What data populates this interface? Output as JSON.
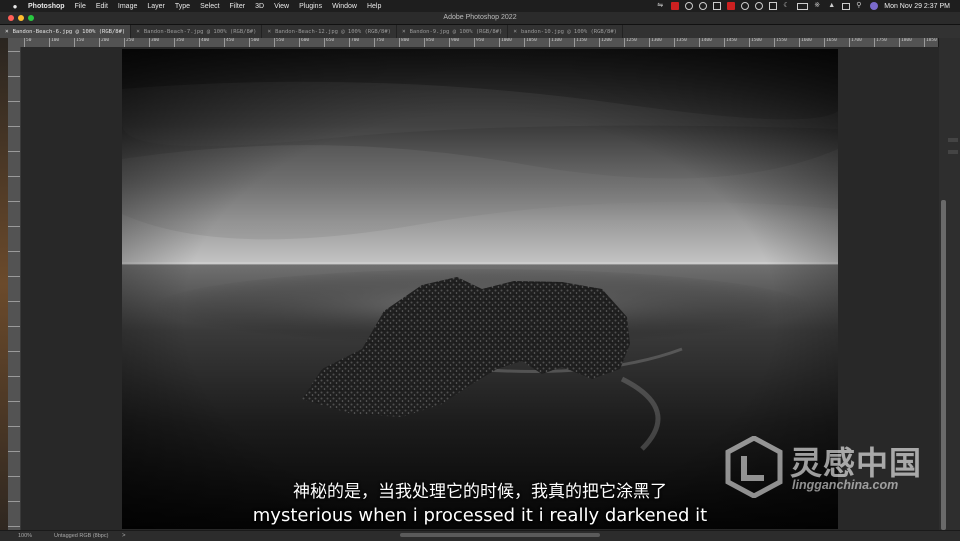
{
  "menubar": {
    "app_name": "Photoshop",
    "items": [
      "File",
      "Edit",
      "Image",
      "Layer",
      "Type",
      "Select",
      "Filter",
      "3D",
      "View",
      "Plugins",
      "Window",
      "Help"
    ],
    "clock": "Mon Nov 29  2:37 PM"
  },
  "window": {
    "title": "Adobe Photoshop 2022",
    "traffic_light_colors": [
      "#ff5f57",
      "#febc2e",
      "#28c840"
    ]
  },
  "tabs": [
    {
      "label": "Bandon-Beach-6.jpg @ 100% (RGB/8#)",
      "active": true
    },
    {
      "label": "Bandon-Beach-7.jpg @ 100% (RGB/8#)",
      "active": false
    },
    {
      "label": "Bandon-Beach-12.jpg @ 100% (RGB/8#)",
      "active": false
    },
    {
      "label": "Bandon-9.jpg @ 100% (RGB/8#)",
      "active": false
    },
    {
      "label": "bandon-10.jpg @ 100% (RGB/8#)",
      "active": false
    }
  ],
  "ruler_top_labels": [
    "50",
    "100",
    "150",
    "200",
    "250",
    "300",
    "350",
    "400",
    "450",
    "500",
    "550",
    "600",
    "650",
    "700",
    "750",
    "800",
    "850",
    "900",
    "950",
    "1000",
    "1050",
    "1100",
    "1150",
    "1200",
    "1250",
    "1300",
    "1350",
    "1400",
    "1450",
    "1500",
    "1550",
    "1600",
    "1650",
    "1700",
    "1750",
    "1800",
    "1850"
  ],
  "statusbar": {
    "zoom": "100%",
    "doc_info": "Untagged RGB (8bpc)",
    "arrow": ">"
  },
  "subtitles": {
    "chinese": "神秘的是，当我处理它的时候，我真的把它涂黑了",
    "english": "mysterious when i processed it i really darkened it"
  },
  "watermark": {
    "chinese": "灵感中国",
    "url": "lingganchina.com"
  }
}
